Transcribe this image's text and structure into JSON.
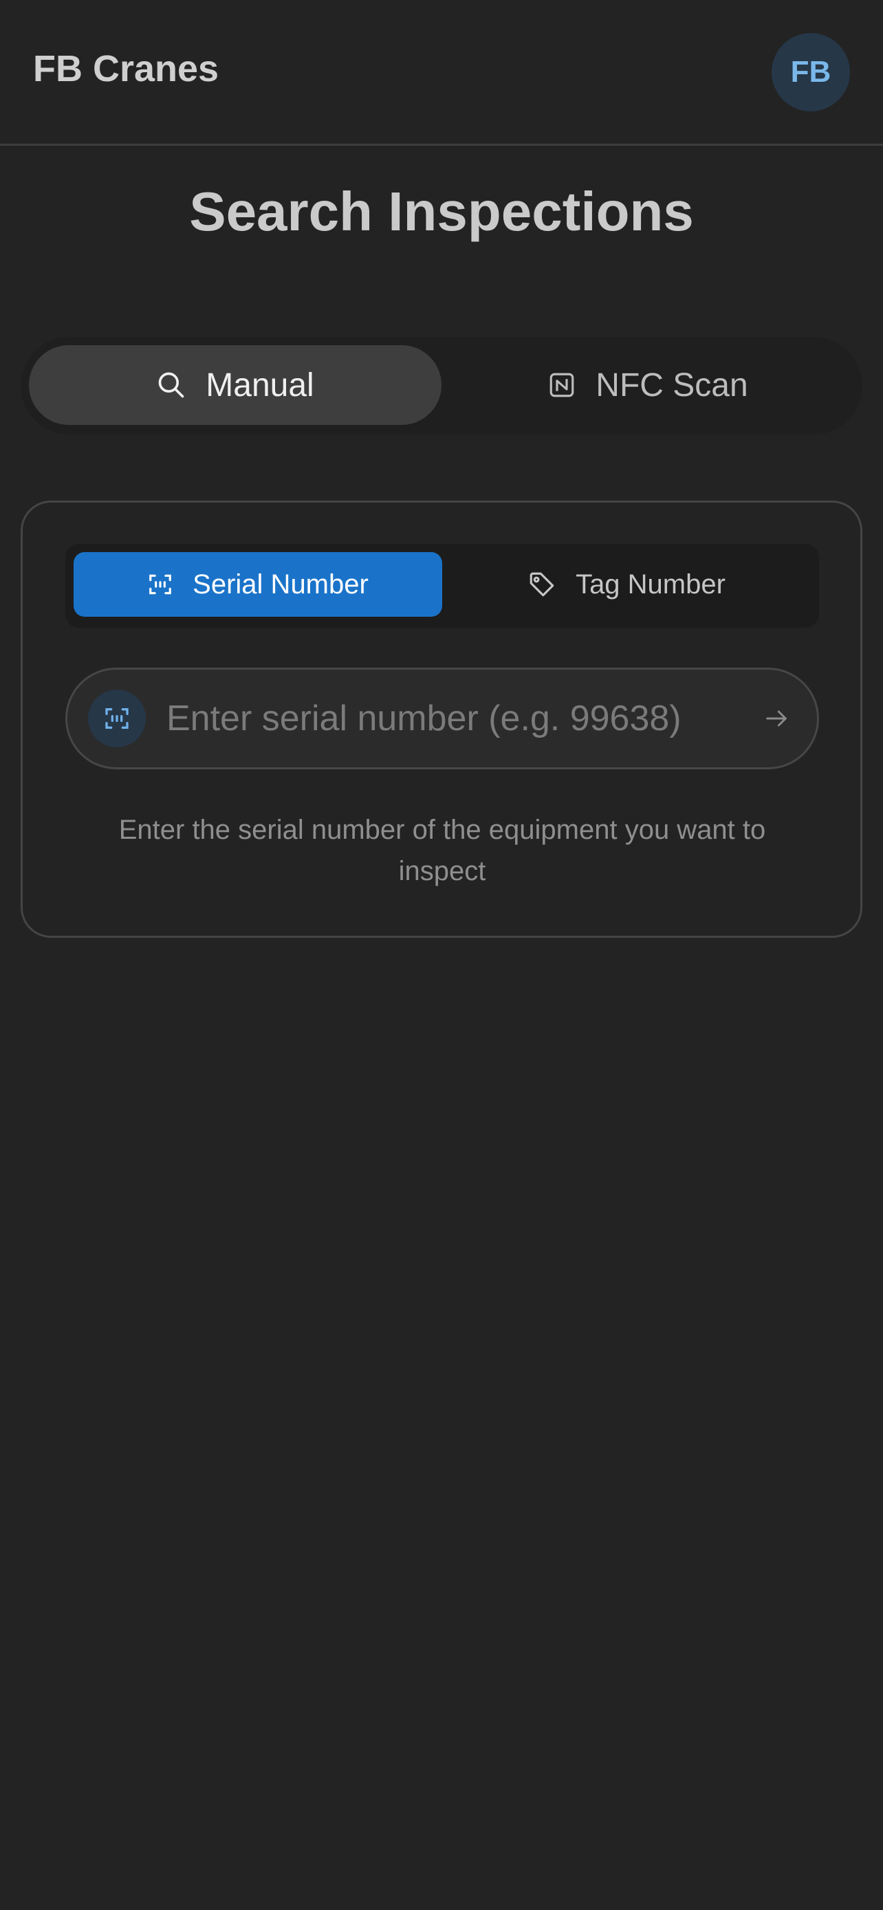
{
  "header": {
    "app_title": "FB Cranes",
    "avatar_initials": "FB"
  },
  "page": {
    "title": "Search Inspections"
  },
  "mode_tabs": [
    {
      "label": "Manual",
      "icon": "search-icon",
      "selected": true
    },
    {
      "label": "NFC Scan",
      "icon": "nfc-icon",
      "selected": false
    }
  ],
  "search_card": {
    "type_tabs": [
      {
        "label": "Serial Number",
        "icon": "barcode-scan-icon",
        "selected": true
      },
      {
        "label": "Tag Number",
        "icon": "tag-icon",
        "selected": false
      }
    ],
    "input": {
      "value": "",
      "placeholder": "Enter serial number (e.g. 99638)"
    },
    "help_text": "Enter the serial number of the equipment you want to inspect"
  },
  "colors": {
    "background": "#232323",
    "accent": "#1a73c9",
    "avatar_bg": "#263748",
    "avatar_text": "#7ab8ea"
  }
}
